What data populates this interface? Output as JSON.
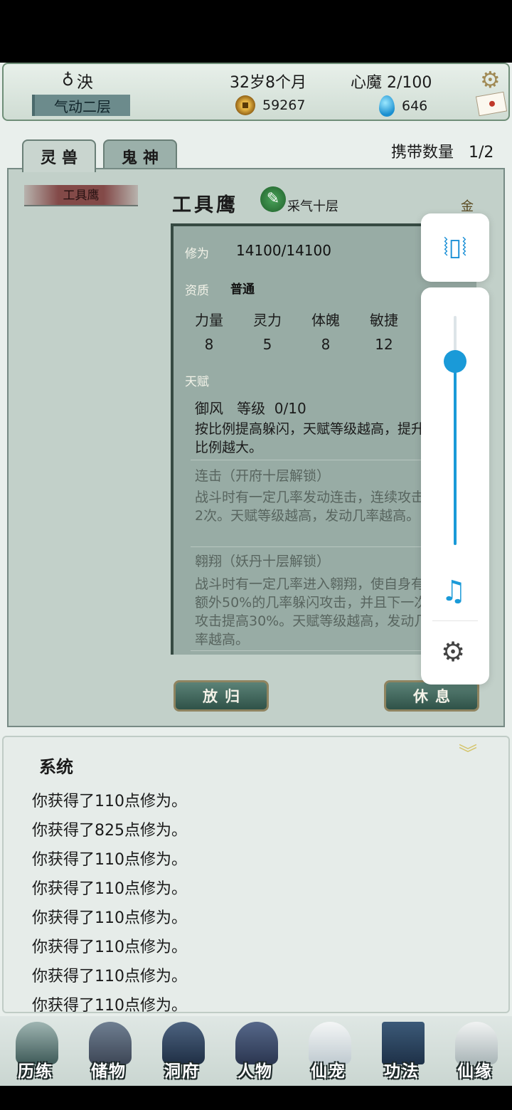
{
  "header": {
    "name": "泱",
    "realm": "气动二层",
    "age": "32岁8个月",
    "demon": "心魔 2/100",
    "coins": "59267",
    "gems": "646"
  },
  "tabs": {
    "spirit_beast": "灵兽",
    "ghost_god": "鬼神"
  },
  "carry": {
    "label": "携带数量",
    "value": "1/2"
  },
  "pet": {
    "list_name": "工具鹰",
    "name": "工具鹰",
    "level": "采气十层",
    "element": "金",
    "cultivation_label": "修为",
    "cultivation": "14100/14100",
    "aptitude_label": "资质",
    "aptitude": "普通",
    "stats": [
      {
        "name": "力量",
        "value": "8"
      },
      {
        "name": "灵力",
        "value": "5"
      },
      {
        "name": "体魄",
        "value": "8"
      },
      {
        "name": "敏捷",
        "value": "12"
      }
    ],
    "talent_label": "天赋",
    "talents": [
      {
        "name": "御风",
        "level_label": "等级",
        "level": "0/10",
        "desc": "按比例提高躲闪，天赋等级越高，提升比例越大。"
      },
      {
        "name": "连击（开府十层解锁）",
        "desc": "战斗时有一定几率发动连击，连续攻击2次。天赋等级越高，发动几率越高。"
      },
      {
        "name": "翱翔（妖丹十层解锁）",
        "desc": "战斗时有一定几率进入翱翔，使自身有额外50%的几率躲闪攻击，并且下一次攻击提高30%。天赋等级越高，发动几率越高。"
      }
    ]
  },
  "buttons": {
    "release": "放归",
    "rest": "休息"
  },
  "system": {
    "title": "系统",
    "log": [
      "你获得了110点修为。",
      "你获得了825点修为。",
      "你获得了110点修为。",
      "你获得了110点修为。",
      "你获得了110点修为。",
      "你获得了110点修为。",
      "你获得了110点修为。",
      "你获得了110点修为。"
    ]
  },
  "nav": [
    {
      "label": "历练",
      "icon": "mountain-icon"
    },
    {
      "label": "储物",
      "icon": "bag-icon"
    },
    {
      "label": "洞府",
      "icon": "pagoda-icon"
    },
    {
      "label": "人物",
      "icon": "person-icon"
    },
    {
      "label": "仙宠",
      "icon": "ghost-icon"
    },
    {
      "label": "功法",
      "icon": "book-icon"
    },
    {
      "label": "仙缘",
      "icon": "crane-icon"
    }
  ],
  "volume_overlay": {
    "level": 0.8
  },
  "colors": {
    "accent_blue": "#1a9ad8",
    "panel_green": "#c2d0c9",
    "button_green": "#3c6358"
  }
}
